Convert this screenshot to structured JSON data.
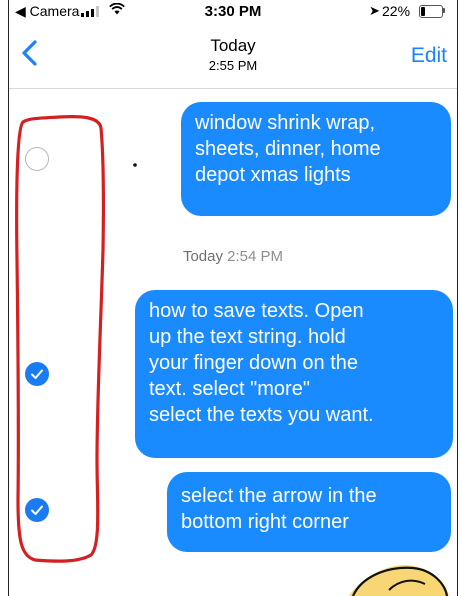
{
  "status_bar": {
    "back_app": "◀ Camera",
    "time": "3:30 PM",
    "location_glyph": "➤",
    "battery_percent": "22%",
    "battery_level": 0.22
  },
  "nav": {
    "title": "Today",
    "subtitle": "2:55 PM",
    "edit_label": "Edit"
  },
  "messages": [
    {
      "lines": [
        "window shrink wrap,",
        "sheets, dinner, home",
        "depot xmas lights"
      ],
      "selected": false
    },
    {
      "lines": [
        "how to save texts. Open",
        "up the text string. hold",
        "your finger down on the",
        "text. select \"more\"",
        "select the texts you want."
      ],
      "selected": true
    },
    {
      "lines": [
        "select the arrow in the",
        "bottom right corner"
      ],
      "selected": true
    }
  ],
  "timestamp": {
    "day": "Today",
    "time": "2:54 PM"
  },
  "colors": {
    "bubble": "#1a8aff",
    "accent": "#1a82fb",
    "annotation": "#d42020"
  }
}
